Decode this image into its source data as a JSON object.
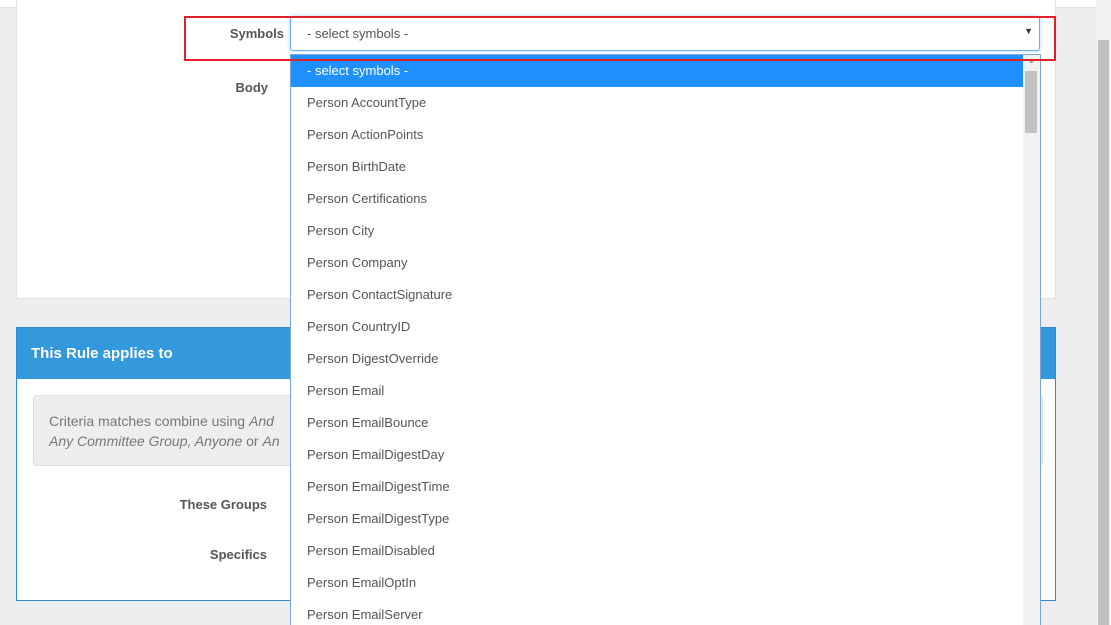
{
  "form": {
    "symbols_label": "Symbols",
    "body_label": "Body"
  },
  "symbols_select": {
    "value": "- select symbols -",
    "caret": "▼"
  },
  "dropdown": {
    "options": [
      "- select symbols -",
      "Person AccountType",
      "Person ActionPoints",
      "Person BirthDate",
      "Person Certifications",
      "Person City",
      "Person Company",
      "Person ContactSignature",
      "Person CountryID",
      "Person DigestOverride",
      "Person Email",
      "Person EmailBounce",
      "Person EmailDigestDay",
      "Person EmailDigestTime",
      "Person EmailDigestType",
      "Person EmailDisabled",
      "Person EmailOptIn",
      "Person EmailServer"
    ],
    "selected_index": 0,
    "scroll_up": "▲"
  },
  "rule_panel": {
    "heading": "This Rule applies to",
    "criteria_line1_prefix": "Criteria matches combine using ",
    "criteria_line1_em": "And",
    "criteria_line2_em1": "Any Committee Group, Anyone",
    "criteria_line2_mid": " or ",
    "criteria_line2_em2": "An",
    "groups_label": "These Groups",
    "specifics_label": "Specifics"
  },
  "colors": {
    "accent": "#3398dc",
    "selected_option": "#1e90ff",
    "highlight": "#e0202b"
  }
}
